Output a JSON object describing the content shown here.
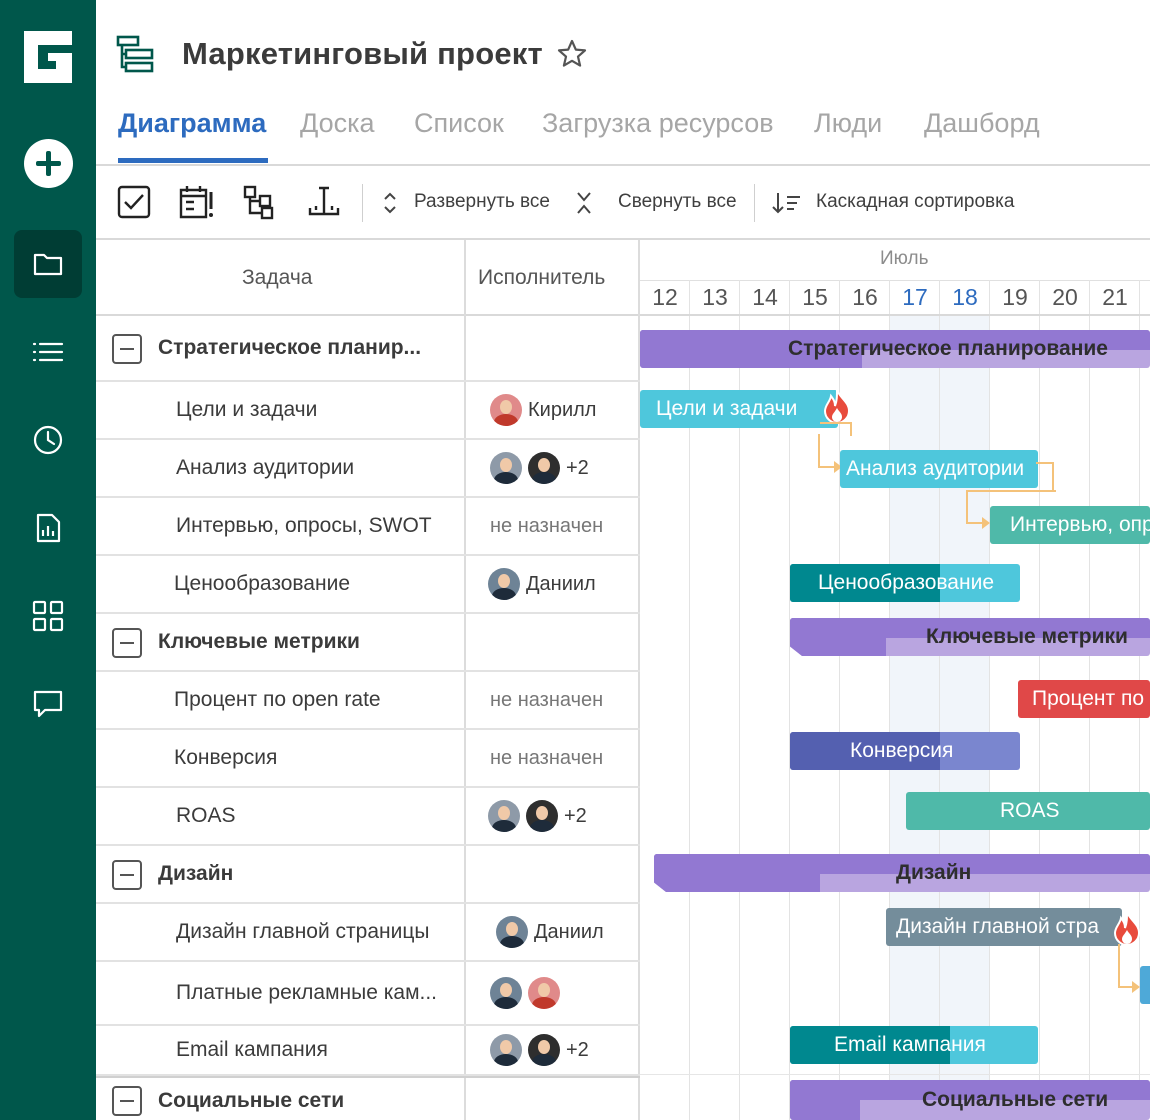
{
  "app": {
    "project_title": "Маркетинговый проект"
  },
  "tabs": [
    {
      "label": "Диаграмма",
      "active": true
    },
    {
      "label": "Доска"
    },
    {
      "label": "Список"
    },
    {
      "label": "Загрузка ресурсов"
    },
    {
      "label": "Люди"
    },
    {
      "label": "Дашборд"
    }
  ],
  "toolbar": {
    "expand_all": "Развернуть все",
    "collapse_all": "Свернуть все",
    "cascade_sort": "Каскадная сортировка"
  },
  "grid": {
    "col_task": "Задача",
    "col_assignee": "Исполнитель"
  },
  "timeline": {
    "month": "Июль",
    "days": [
      "12",
      "13",
      "14",
      "15",
      "16",
      "17",
      "18",
      "19",
      "20",
      "21"
    ],
    "highlight_days": [
      "17",
      "18"
    ]
  },
  "rows": [
    {
      "task": "Стратегическое планир...",
      "group": true,
      "assignee": ""
    },
    {
      "task": "Цели и задачи",
      "assignee": "Кирилл"
    },
    {
      "task": "Анализ аудитории",
      "assignee": "+2"
    },
    {
      "task": "Интервью, опросы, SWOT",
      "assignee": "не назначен"
    },
    {
      "task": "Ценообразование",
      "assignee": "Даниил"
    },
    {
      "task": "Ключевые метрики",
      "group": true,
      "assignee": ""
    },
    {
      "task": "Процент по open rate",
      "assignee": "не назначен"
    },
    {
      "task": "Конверсия",
      "assignee": "не назначен"
    },
    {
      "task": "ROAS",
      "assignee": "+2"
    },
    {
      "task": "Дизайн",
      "group": true,
      "assignee": ""
    },
    {
      "task": "Дизайн главной страницы",
      "assignee": "Даниил"
    },
    {
      "task": "Платные рекламные кам...",
      "assignee": ""
    },
    {
      "task": "Email кампания",
      "assignee": "+2"
    },
    {
      "task": "Социальные сети",
      "group": true,
      "assignee": ""
    }
  ],
  "bars": [
    {
      "label": "Стратегическое планирование"
    },
    {
      "label": "Цели и задачи"
    },
    {
      "label": "Анализ аудитории"
    },
    {
      "label": "Интервью, опр"
    },
    {
      "label": "Ценообразование"
    },
    {
      "label": "Ключевые метрики"
    },
    {
      "label": "Процент по"
    },
    {
      "label": "Конверсия"
    },
    {
      "label": "ROAS"
    },
    {
      "label": "Дизайн"
    },
    {
      "label": "Дизайн главной стра"
    },
    {
      "label": "Email кампания"
    },
    {
      "label": "Социальные сети"
    }
  ],
  "colors": {
    "sidebar": "#00574b",
    "accent": "#2d6bbf",
    "group_bar": "#9278d2",
    "task_cyan": "#4ec7dc",
    "task_teal": "#4fb9a9",
    "task_dark_teal": "#00888f",
    "task_red": "#e04848",
    "task_indigo": "#5460b0",
    "task_slate": "#748d9b"
  }
}
